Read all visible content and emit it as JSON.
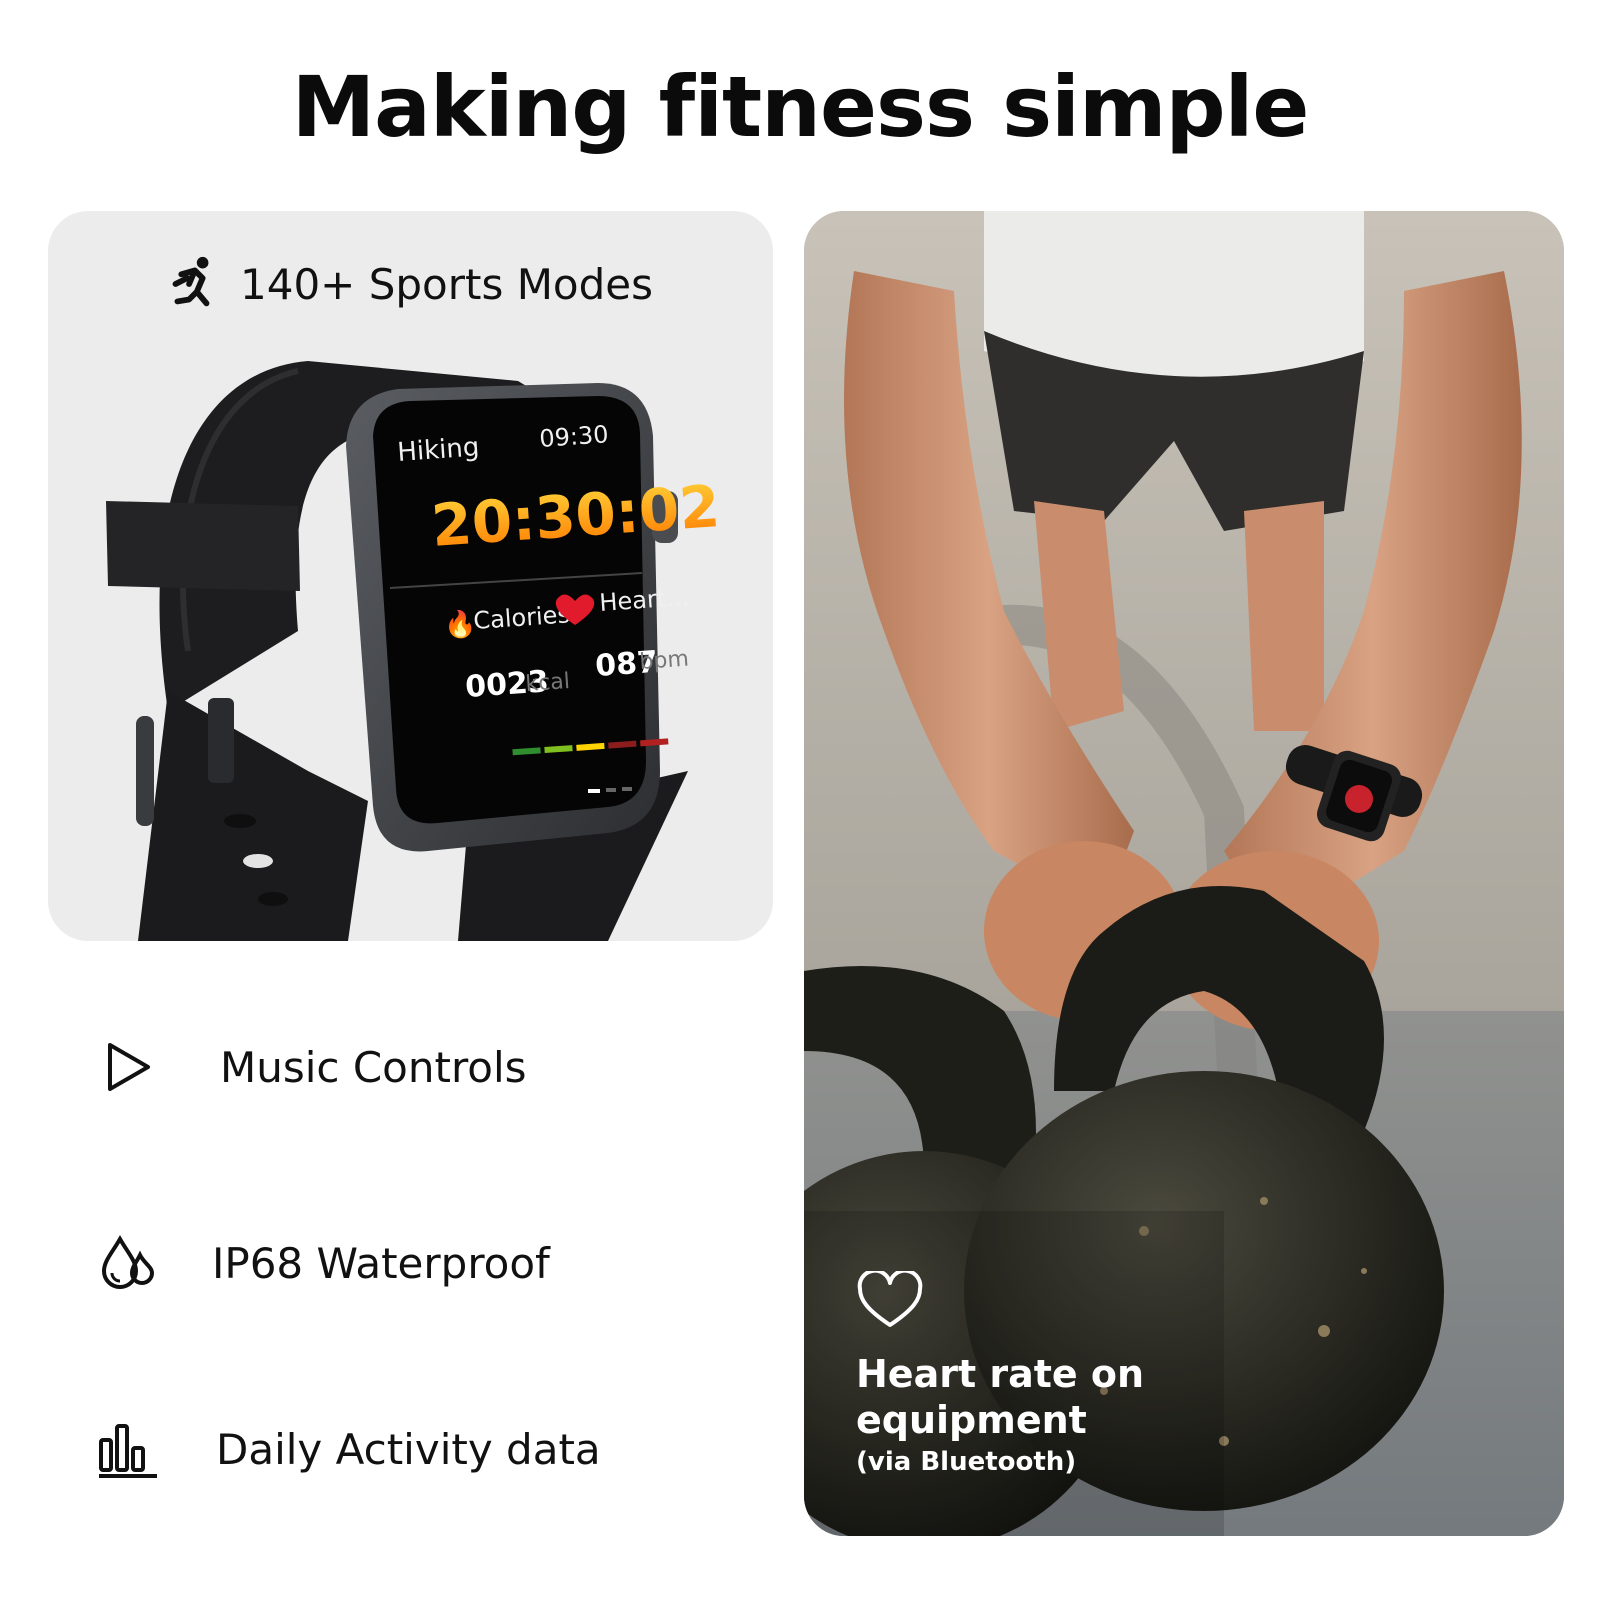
{
  "headline": "Making fitness simple",
  "sports_card": {
    "title": "140+ Sports Modes",
    "icon": "running-person-icon",
    "background": "#ececec",
    "watch_screen": {
      "activity": "Hiking",
      "time": "09:30",
      "elapsed": "20:30:02",
      "calories_label": "Calories",
      "heart_label": "Heart...",
      "calories_value": "0023",
      "calories_unit": "kcal",
      "heart_value": "087",
      "heart_unit": "bpm"
    }
  },
  "features": [
    {
      "icon": "play-icon",
      "label": "Music Controls"
    },
    {
      "icon": "water-drops-icon",
      "label": "IP68 Waterproof"
    },
    {
      "icon": "bar-chart-icon",
      "label": "Daily Activity data"
    }
  ],
  "photo_card": {
    "icon": "heart-outline-icon",
    "title": "Heart rate on equipment",
    "subtitle": "(via Bluetooth)"
  }
}
